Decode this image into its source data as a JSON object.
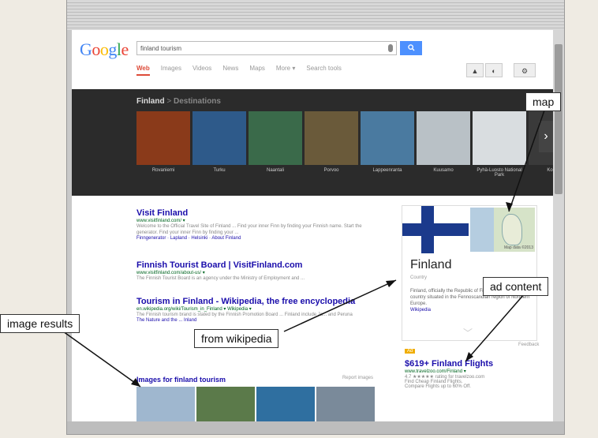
{
  "search": {
    "logo": "Google",
    "query": "finland tourism",
    "button_icon": "search-icon"
  },
  "tabs": [
    "Web",
    "Images",
    "Videos",
    "News",
    "Maps",
    "More ▾",
    "Search tools"
  ],
  "topbar": {
    "share_label": "▲",
    "gear_label": "⚙"
  },
  "carousel": {
    "crumb": "Finland",
    "crumb_sep": ">",
    "crumb_dest": "Destinations",
    "items": [
      "Rovaniemi",
      "Turku",
      "Naantali",
      "Porvoo",
      "Lappeenranta",
      "Kuusamo",
      "Pyhä-Luosto National Park",
      "Kokkola"
    ],
    "colors": [
      "#8a3a1a",
      "#2e5a8a",
      "#3a6a4a",
      "#6a5a3a",
      "#4a7aa0",
      "#b9c1c6",
      "#d9dde0",
      "#3a3a3a"
    ]
  },
  "results": [
    {
      "title": "Visit Finland",
      "url": "www.visitfinland.com/ ▾",
      "snippet": "Welcome to the Official Travel Site of Finland ... Find your inner Finn by finding your Finnish name. Start the generator. Find your inner Finn by finding your ...",
      "links": "Finngenerator · Lapland · Helsinki · About Finland"
    },
    {
      "title": "Finnish Tourist Board | VisitFinland.com",
      "url": "www.visitfinland.com/about-us/ ▾",
      "snippet": "The Finnish Tourist Board is an agency under the Ministry of Employment and ...",
      "links": ""
    },
    {
      "title": "Tourism in Finland - Wikipedia, the free encyclopedia",
      "url": "en.wikipedia.org/wiki/Tourism_in_Finland ▾ Wikipedia ▾",
      "snippet": "The Finnish tourism brand is stated by the Finnish Promotion Board ... Finland include Ja... and Peruna",
      "links": "The Nature and the ... Inland"
    }
  ],
  "knowledge": {
    "title": "Finland",
    "subtitle": "Country",
    "text": "Finland, officially the Republic of Finland, is a Nordic country situated in the Fennoscandian region of Northern Europe.",
    "source": "Wikipedia",
    "map_caption": "Map data ©2013",
    "feedback": "Feedback"
  },
  "images_section": {
    "heading": "Images for finland tourism",
    "report": "Report images",
    "colors": [
      "#9fb7cf",
      "#5b7a4a",
      "#2f6fa0",
      "#7a8a9a"
    ]
  },
  "ad": {
    "badge": "Ad",
    "title": "$619+ Finland Flights",
    "url": "www.travelzoo.com/Finland ▾",
    "rating_line": "4.7 ★★★★★ rating for travelzoo.com",
    "line1": "Find Cheap Finland Flights.",
    "line2": "Compare Flights up to 60% Off."
  },
  "callouts": {
    "map": "map",
    "ad_content": "ad content",
    "image_results": "image results",
    "from_wikipedia": "from wikipedia"
  }
}
